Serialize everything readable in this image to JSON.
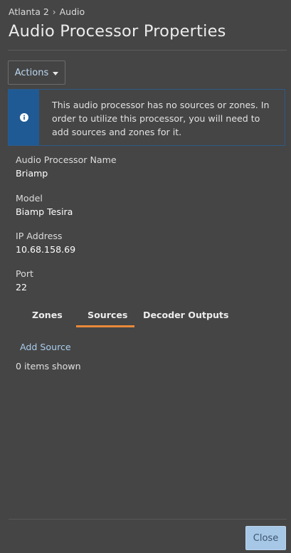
{
  "breadcrumb": {
    "parent": "Atlanta 2",
    "separator": "›",
    "current": "Audio"
  },
  "page_title": "Audio Processor Properties",
  "actions": {
    "label": "Actions",
    "icon": "caret-down-icon"
  },
  "alert": {
    "icon": "info-icon",
    "message": "This audio processor has no sources or zones. In order to utilize this processor, you will need to add sources and zones for it.",
    "colors": {
      "bar": "#1f5a94",
      "border": "#2e5a86"
    }
  },
  "properties": [
    {
      "label": "Audio Processor Name",
      "value": "Briamp"
    },
    {
      "label": "Model",
      "value": "Biamp Tesira"
    },
    {
      "label": "IP Address",
      "value": "10.68.158.69"
    },
    {
      "label": "Port",
      "value": "22"
    }
  ],
  "tabs": [
    {
      "label": "Zones",
      "selected": false
    },
    {
      "label": "Sources",
      "selected": true
    },
    {
      "label": "Decoder Outputs",
      "selected": false
    }
  ],
  "tab_panel": {
    "add_link": "Add Source",
    "items_count_text": "0 items shown"
  },
  "footer": {
    "close_label": "Close"
  },
  "colors": {
    "background": "#454545",
    "accent_underline": "#e8893a",
    "link": "#a9cdee",
    "close_button": "#a6c7e6"
  }
}
